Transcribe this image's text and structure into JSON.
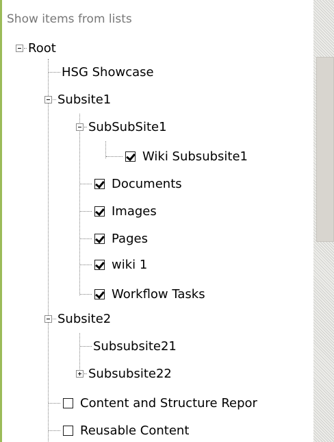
{
  "panel": {
    "header": "Show items from lists"
  },
  "tree": {
    "root": "Root",
    "hsg_showcase": "HSG Showcase",
    "subsite1": "Subsite1",
    "subsubsite1": "SubSubSite1",
    "wiki_subsubsite1": "Wiki Subsubsite1",
    "documents": "Documents",
    "images": "Images",
    "pages": "Pages",
    "wiki_1": "wiki 1",
    "workflow_tasks": "Workflow Tasks",
    "subsite2": "Subsite2",
    "subsubsite21": "Subsubsite21",
    "subsubsite22": "Subsubsite22",
    "content_structure": "Content and Structure Repor",
    "reusable_content": "Reusable Content"
  },
  "checks": {
    "wiki_subsubsite1": true,
    "documents": true,
    "images": true,
    "pages": true,
    "wiki_1": true,
    "workflow_tasks": true,
    "content_structure": false,
    "reusable_content": false
  }
}
